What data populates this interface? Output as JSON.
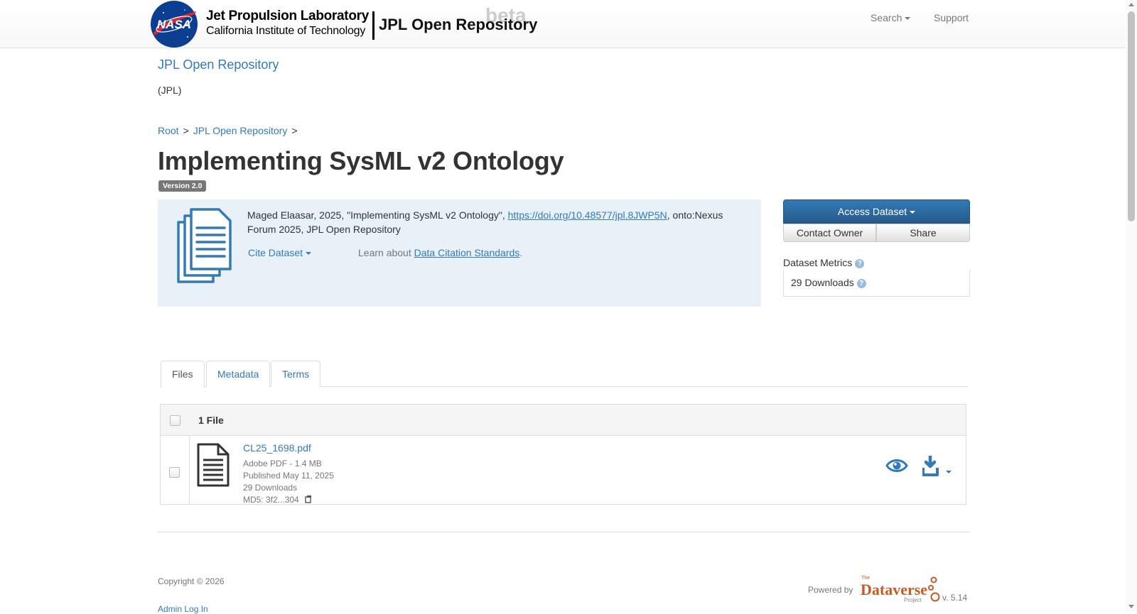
{
  "navbar": {
    "lab_name": "Jet Propulsion Laboratory",
    "institution": "California Institute of Technology",
    "repo_brand": "JPL Open Repository",
    "beta": "beta",
    "search_label": "Search",
    "support_label": "Support",
    "logo_text": "NASA"
  },
  "dataverse": {
    "name": "JPL Open Repository",
    "affiliation": "(JPL)"
  },
  "breadcrumb": {
    "items": [
      "Root",
      "JPL Open Repository"
    ],
    "separator": ">"
  },
  "dataset": {
    "title": "Implementing SysML v2 Ontology",
    "version": "Version 2.0"
  },
  "citation": {
    "text_before": "Maged Elaasar, 2025, \"Implementing SysML v2 Ontology\", ",
    "doi_link": "https://doi.org/10.48577/jpl.8JWP5N",
    "text_after": ", onto:Nexus Forum 2025, JPL Open Repository",
    "cite_button": "Cite Dataset",
    "learn_prefix": "Learn about ",
    "learn_link": "Data Citation Standards",
    "learn_suffix": "."
  },
  "actions": {
    "access_dataset": "Access Dataset",
    "contact_owner": "Contact Owner",
    "share": "Share"
  },
  "metrics": {
    "label": "Dataset Metrics",
    "downloads": "29 Downloads",
    "help_glyph": "?"
  },
  "tabs": [
    {
      "label": "Files",
      "active": true
    },
    {
      "label": "Metadata",
      "active": false
    },
    {
      "label": "Terms",
      "active": false
    }
  ],
  "files": {
    "count_label": "1 File",
    "rows": [
      {
        "name": "CL25_1698.pdf",
        "type_size": "Adobe PDF - 1.4 MB",
        "published": "Published May 11, 2025",
        "downloads": "29 Downloads",
        "md5": "MD5: 3f2...304"
      }
    ]
  },
  "footer": {
    "copyright": "Copyright © 2026",
    "admin_login": "Admin Log In",
    "powered_by": "Powered by",
    "dataverse_the": "The",
    "dataverse_word": "Dataverse",
    "dataverse_project": "Project",
    "version": "v. 5.14"
  },
  "colors": {
    "link": "#337ab7",
    "primary": "#265a88",
    "citation_bg": "#e8f0f8",
    "badge": "#777777",
    "dataverse_orange": "#c55b28"
  },
  "icons": [
    "nasa-logo",
    "caret-down-icon",
    "document-stack-icon",
    "help-icon",
    "file-pdf-icon",
    "eye-icon",
    "download-icon",
    "copy-icon"
  ]
}
